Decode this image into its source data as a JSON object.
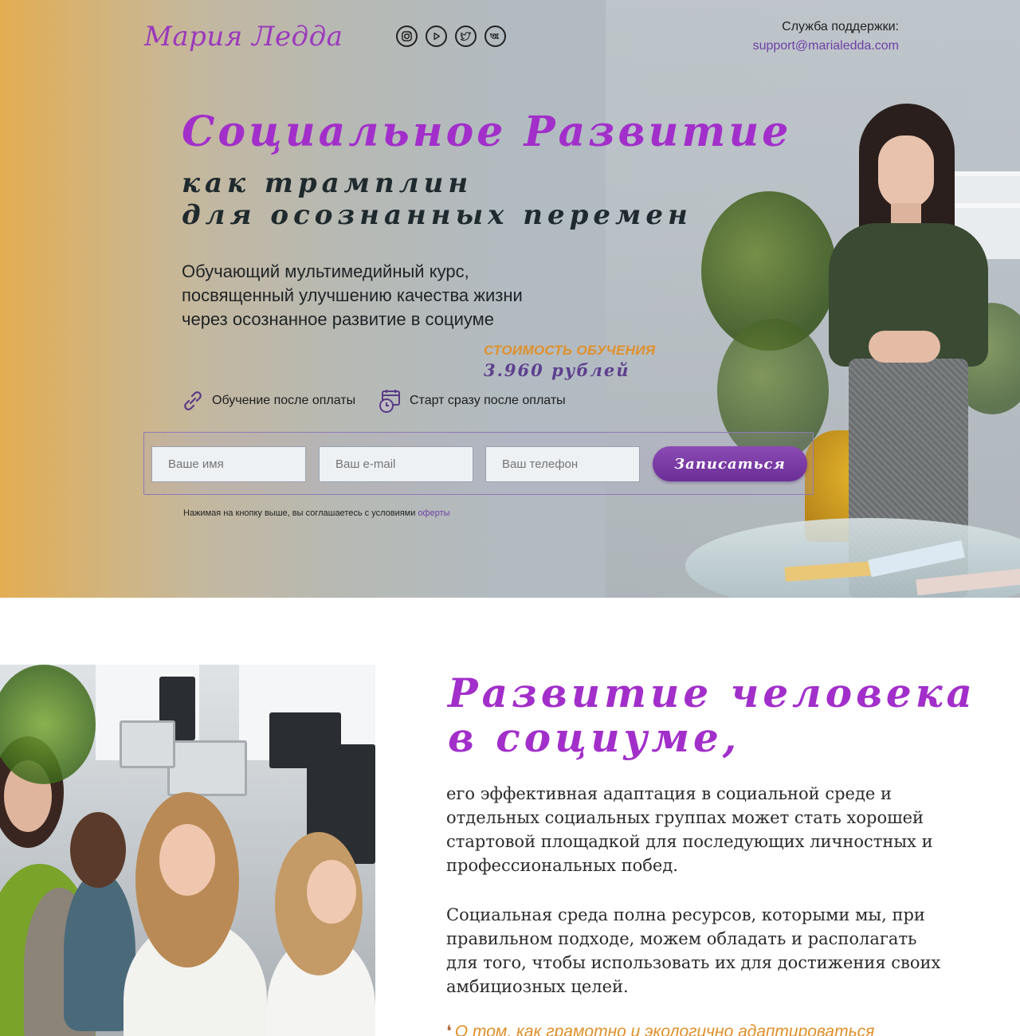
{
  "header": {
    "logo": "Мария Ледда",
    "socials": [
      {
        "icon": "instagram-icon"
      },
      {
        "icon": "youtube-icon"
      },
      {
        "icon": "twitter-icon"
      },
      {
        "icon": "vk-icon"
      }
    ],
    "support_label": "Служба поддержки:",
    "support_email": "support@marialedda.com"
  },
  "hero": {
    "title": "Социальное  Развитие",
    "subtitle_line1": "как  трамплин",
    "subtitle_line2": "для  осознанных  перемен",
    "lead_line1": "Обучающий мультимедийный курс,",
    "lead_line2": "посвященный улучшению качества жизни",
    "lead_line3": "через осознанное развитие в социуме",
    "price_label": "СТОИМОСТЬ ОБУЧЕНИЯ",
    "price_value": "3.960  рублей",
    "features": [
      {
        "icon": "link-icon",
        "text": "Обучение после оплаты"
      },
      {
        "icon": "calendar-clock-icon",
        "text": "Старт сразу после оплаты"
      }
    ]
  },
  "form": {
    "name_placeholder": "Ваше имя",
    "email_placeholder": "Ваш e-mail",
    "phone_placeholder": "Ваш телефон",
    "submit_label": "Записаться",
    "agree_text": "Нажимая на кнопку выше, вы соглашаетесь с условиями ",
    "agree_link": "оферты"
  },
  "section2": {
    "title_line1": "Развитие  человека",
    "title_line2": "в  социуме,",
    "para1_lines": [
      "его эффективная адаптация в социальной среде и",
      "отдельных социальных группах может стать хорошей",
      "стартовой площадкой для последующих личностных и",
      "профессиональных побед."
    ],
    "para2_lines": [
      "Социальная среда полна ресурсов, которыми мы, при",
      "правильном подходе, можем обладать и располагать",
      "для того, чтобы использовать их для достижения своих",
      "амбициозных целей."
    ],
    "teaser": "О том, как грамотно и экологично адаптироваться"
  },
  "colors": {
    "accent_purple": "#a22fca",
    "button_purple": "#6b2d96",
    "price_orange": "#e0902a",
    "link_purple": "#6f3fa6"
  }
}
